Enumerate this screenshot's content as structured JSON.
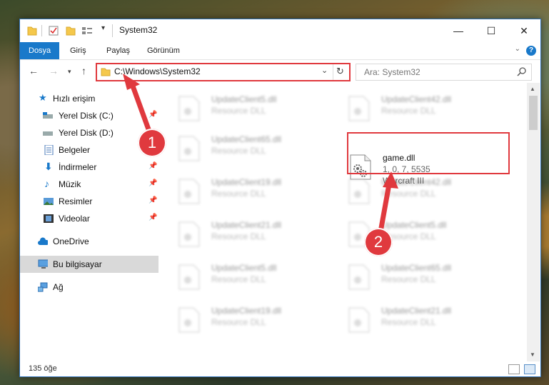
{
  "window": {
    "title": "System32",
    "controls": {
      "minimize": "—",
      "maximize": "☐",
      "close": "✕"
    }
  },
  "ribbon": {
    "tabs": [
      {
        "label": "Dosya",
        "active": true
      },
      {
        "label": "Giriş"
      },
      {
        "label": "Paylaş"
      },
      {
        "label": "Görünüm"
      }
    ],
    "help": "?"
  },
  "address": {
    "path": "C:\\Windows\\System32"
  },
  "search": {
    "placeholder": "Ara: System32"
  },
  "sidebar": {
    "items": [
      {
        "label": "Hızlı erişim"
      },
      {
        "label": "Yerel Disk (C:)"
      },
      {
        "label": "Yerel Disk (D:)"
      },
      {
        "label": "Belgeler"
      },
      {
        "label": "İndirmeler"
      },
      {
        "label": "Müzik"
      },
      {
        "label": "Resimler"
      },
      {
        "label": "Videolar"
      },
      {
        "label": "OneDrive"
      },
      {
        "label": "Bu bilgisayar",
        "selected": true
      },
      {
        "label": "Ağ"
      }
    ]
  },
  "files": {
    "left": [
      {
        "name": "UpdateClient5.dll",
        "type": "Resource DLL"
      },
      {
        "name": "UpdateClient65.dll",
        "type": "Resource DLL"
      },
      {
        "name": "UpdateClient19.dll",
        "type": "Resource DLL"
      },
      {
        "name": "UpdateClient21.dll",
        "type": "Resource DLL"
      },
      {
        "name": "UpdateClient5.dll",
        "type": "Resource DLL"
      },
      {
        "name": "UpdateClient19.dll",
        "type": "Resource DLL"
      }
    ],
    "right": [
      {
        "name": "UpdateClient42.dll",
        "type": "Resource DLL"
      },
      {
        "name": "game.dll",
        "version": "1, 0, 7, 5535",
        "product": "Warcraft III",
        "highlight": true
      },
      {
        "name": "UpdateClient42.dll",
        "type": "Resource DLL"
      },
      {
        "name": "UpdateClient5.dll",
        "type": "Resource DLL"
      },
      {
        "name": "UpdateClient65.dll",
        "type": "Resource DLL"
      },
      {
        "name": "UpdateClient21.dll",
        "type": "Resource DLL"
      }
    ]
  },
  "annotations": {
    "badge1": "1",
    "badge2": "2"
  },
  "status": {
    "count": "135 öğe"
  },
  "colors": {
    "accent": "#1979ca",
    "highlight": "#e0393e"
  }
}
